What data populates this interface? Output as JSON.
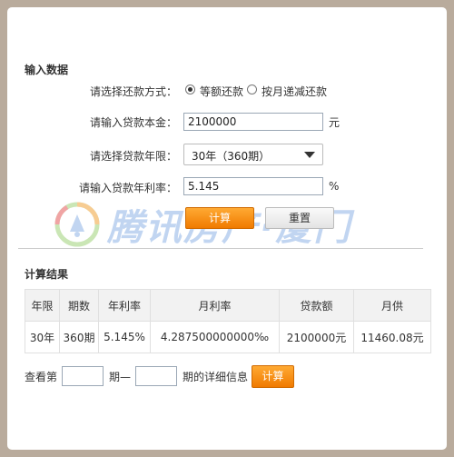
{
  "input_section": {
    "title": "输入数据",
    "repay_method": {
      "label": "请选择还款方式：",
      "options": [
        {
          "label": "等额还款",
          "selected": true
        },
        {
          "label": "按月递减还款",
          "selected": false
        }
      ]
    },
    "principal": {
      "label": "请输入贷款本金：",
      "value": "2100000",
      "unit": "元"
    },
    "term": {
      "label": "请选择贷款年限：",
      "selected": "30年（360期）"
    },
    "rate": {
      "label": "请输入贷款年利率：",
      "value": "5.145",
      "unit": "%"
    },
    "calc_button": "计算",
    "reset_button": "重置"
  },
  "watermark": {
    "text": "腾讯房产·厦门",
    "color": "#8fb3e6"
  },
  "result_section": {
    "title": "计算结果",
    "headers": [
      "年限",
      "期数",
      "年利率",
      "月利率",
      "贷款额",
      "月供"
    ],
    "row": [
      "30年",
      "360期",
      "5.145%",
      "4.287500000000‰",
      "2100000元",
      "11460.08元"
    ]
  },
  "detail_query": {
    "prefix": "查看第",
    "middle": "期—",
    "suffix": "期的详细信息",
    "button": "计算"
  },
  "colors": {
    "accent": "#f07a00",
    "background": "#b9ab9c"
  }
}
